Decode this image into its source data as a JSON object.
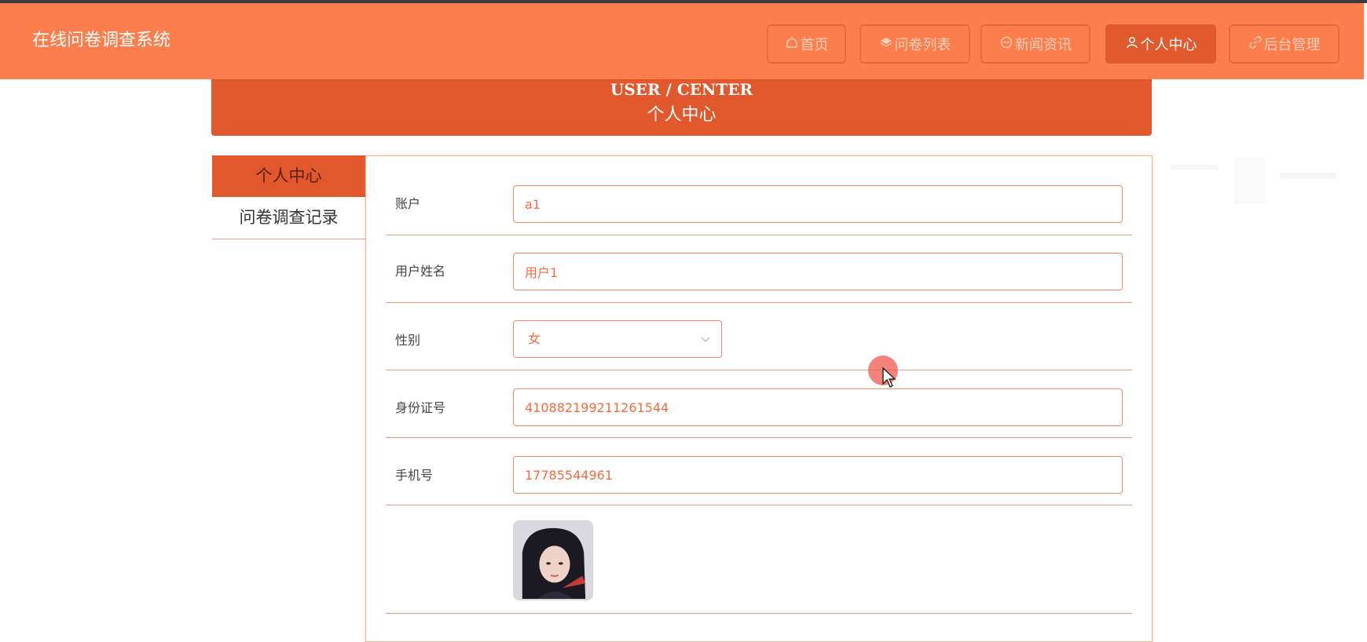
{
  "app": {
    "title": "在线问卷调查系统"
  },
  "nav": [
    {
      "label": "首页",
      "icon": "home-icon"
    },
    {
      "label": "问卷列表",
      "icon": "layers-icon"
    },
    {
      "label": "新闻资讯",
      "icon": "news-icon"
    },
    {
      "label": "个人中心",
      "icon": "user-icon"
    },
    {
      "label": "后台管理",
      "icon": "link-icon"
    }
  ],
  "banner": {
    "title_en": "USER / CENTER",
    "title_cn": "个人中心"
  },
  "side_menu": [
    {
      "label": "个人中心",
      "active": true
    },
    {
      "label": "问卷调查记录",
      "active": false
    }
  ],
  "form": {
    "account": {
      "label": "账户",
      "value": "a1"
    },
    "name": {
      "label": "用户姓名",
      "value": "用户1"
    },
    "gender": {
      "label": "性别",
      "value": "女"
    },
    "id_number": {
      "label": "身份证号",
      "value": "410882199211261544"
    },
    "phone": {
      "label": "手机号",
      "value": "17785544961"
    }
  },
  "colors": {
    "header": "#fd7e4d",
    "accent": "#e0582b",
    "field_border": "#f08a62",
    "field_text": "#f26d3d"
  }
}
